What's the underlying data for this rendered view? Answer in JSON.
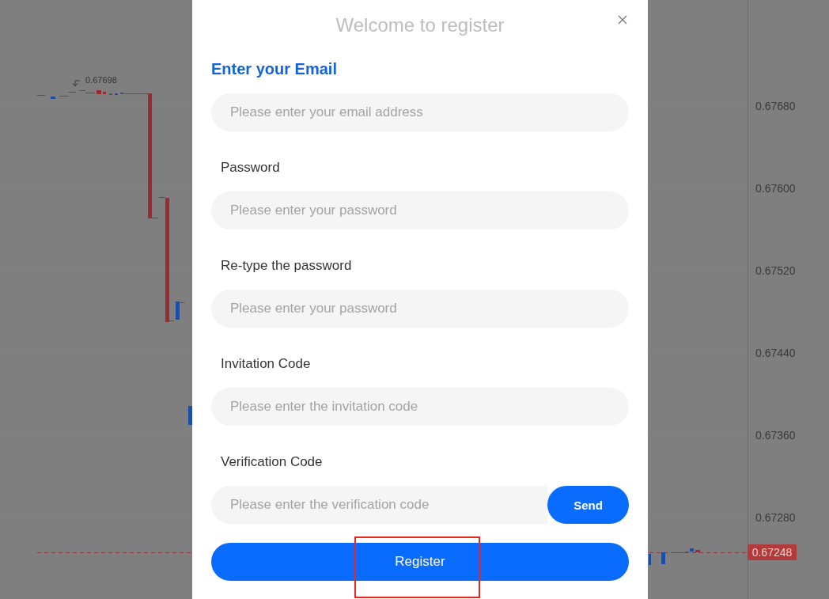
{
  "chart": {
    "high_label": "0.67698",
    "price_axis": [
      "0.67680",
      "0.67600",
      "0.67520",
      "0.67440",
      "0.67360",
      "0.67280"
    ],
    "current_price": "0.67248"
  },
  "dialog": {
    "title": "Welcome to register",
    "heading": "Enter your Email",
    "fields": [
      {
        "placeholder": "Please enter your email address"
      },
      {
        "label": "Password",
        "placeholder": "Please enter your password"
      },
      {
        "label": "Re-type the password",
        "placeholder": "Please enter your password"
      },
      {
        "label": "Invitation Code",
        "placeholder": "Please enter the invitation code"
      },
      {
        "label": "Verification Code",
        "placeholder": "Please enter the verification code",
        "button": "Send"
      }
    ],
    "submit": {
      "label": "Register",
      "highlighted": true
    }
  }
}
